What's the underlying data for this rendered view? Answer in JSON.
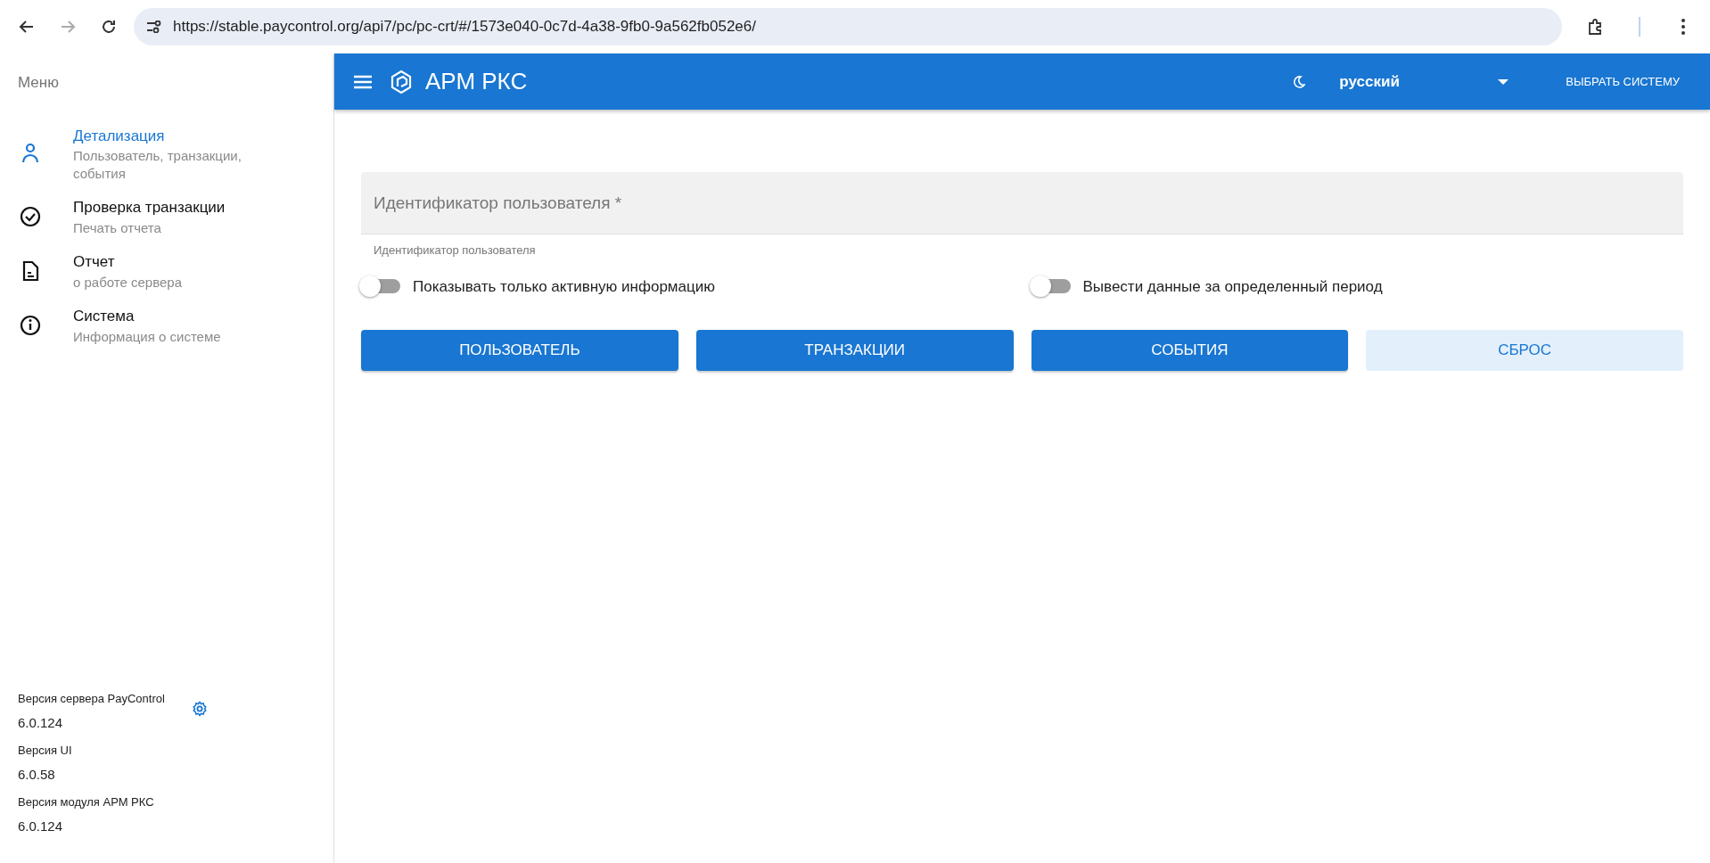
{
  "browser": {
    "url": "https://stable.paycontrol.org/api7/pc/pc-crt/#/1573e040-0c7d-4a38-9fb0-9a562fb052e6/"
  },
  "sidebar": {
    "title": "Меню",
    "items": [
      {
        "kind": "person",
        "label": "Детализация",
        "sublabel": "Пользователь, транзакции, события",
        "selected": true
      },
      {
        "kind": "check",
        "label": "Проверка транзакции",
        "sublabel": "Печать отчета",
        "selected": false
      },
      {
        "kind": "document",
        "label": "Отчет",
        "sublabel": "о работе сервера",
        "selected": false
      },
      {
        "kind": "info",
        "label": "Система",
        "sublabel": "Информация о системе",
        "selected": false
      }
    ],
    "versions": [
      {
        "label": "Версия сервера PayControl",
        "value": "6.0.124",
        "settings": true
      },
      {
        "label": "Версия UI",
        "value": "6.0.58",
        "settings": false
      },
      {
        "label": "Версия модуля АРМ РКС",
        "value": "6.0.124",
        "settings": false
      }
    ]
  },
  "header": {
    "title": "АРМ РКС",
    "language": "русский",
    "system_button": "ВЫБРАТЬ СИСТЕМУ"
  },
  "form": {
    "field": {
      "placeholder": "Идентификатор пользователя *",
      "hint": "Идентификатор пользователя"
    },
    "toggles": [
      {
        "label": "Показывать только активную информацию",
        "on": false
      },
      {
        "label": "Вывести данные за определенный период",
        "on": false
      }
    ],
    "buttons": [
      {
        "label": "ПОЛЬЗОВАТЕЛЬ",
        "kind": "primary"
      },
      {
        "label": "ТРАНЗАКЦИИ",
        "kind": "primary"
      },
      {
        "label": "СОБЫТИЯ",
        "kind": "primary"
      },
      {
        "label": "СБРОС",
        "kind": "light"
      }
    ]
  }
}
